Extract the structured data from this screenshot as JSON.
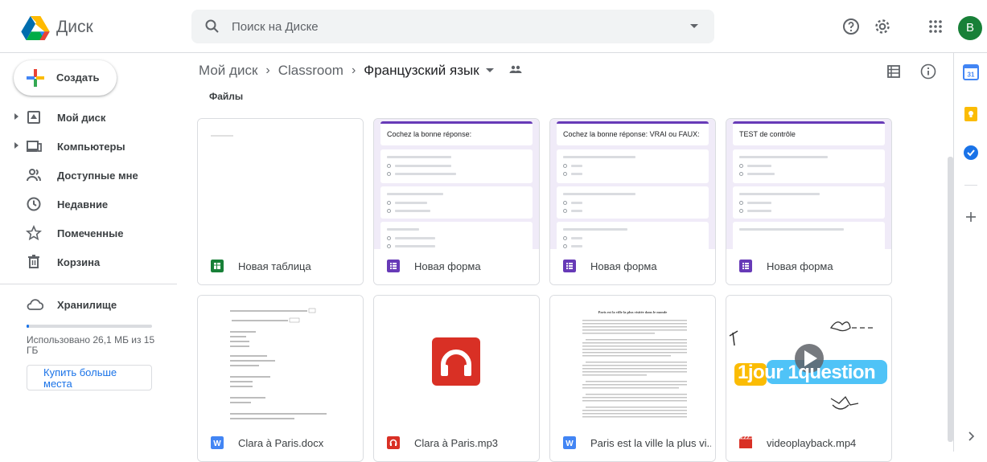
{
  "app": {
    "name": "Диск"
  },
  "search": {
    "placeholder": "Поиск на Диске"
  },
  "header": {
    "avatar_letter": "B",
    "icons": [
      "help-icon",
      "settings-icon",
      "apps-grid-icon"
    ]
  },
  "sidebar": {
    "create_label": "Создать",
    "items": [
      {
        "label": "Мой диск",
        "icon": "drive-icon",
        "expandable": true
      },
      {
        "label": "Компьютеры",
        "icon": "computer-icon",
        "expandable": true
      },
      {
        "label": "Доступные мне",
        "icon": "shared-icon",
        "expandable": false
      },
      {
        "label": "Недавние",
        "icon": "clock-icon",
        "expandable": false
      },
      {
        "label": "Помеченные",
        "icon": "star-icon",
        "expandable": false
      },
      {
        "label": "Корзина",
        "icon": "trash-icon",
        "expandable": false
      }
    ],
    "storage_label": "Хранилище",
    "storage_used": "Использовано 26,1 МБ из 15 ГБ",
    "storage_fraction": 0.002,
    "buy_label": "Купить больше места"
  },
  "breadcrumb": {
    "items": [
      "Мой диск",
      "Classroom",
      "Французский язык"
    ]
  },
  "section": {
    "files_label": "Файлы"
  },
  "files": [
    {
      "name": "Новая таблица",
      "type": "sheets",
      "icon_color": "#188038"
    },
    {
      "name": "Новая форма",
      "type": "forms",
      "icon_color": "#673ab7",
      "thumb_title": "Cochez la bonne réponse:"
    },
    {
      "name": "Новая форма",
      "type": "forms",
      "icon_color": "#673ab7",
      "thumb_title": "Cochez la bonne réponse: VRAI ou FAUX:"
    },
    {
      "name": "Новая форма",
      "type": "forms",
      "icon_color": "#673ab7",
      "thumb_title": "TEST de contrôle"
    },
    {
      "name": "Clara à Paris.docx",
      "type": "docx",
      "icon_color": "#4285f4"
    },
    {
      "name": "Clara à Paris.mp3",
      "type": "audio",
      "icon_color": "#d93025"
    },
    {
      "name": "Paris est la ville la plus vi...",
      "type": "docx",
      "icon_color": "#4285f4",
      "thumb_title": "Paris est la ville la plus visitée dans le monde"
    },
    {
      "name": "videoplayback.mp4",
      "type": "video",
      "icon_color": "#d93025",
      "thumb_title": "1jour 1question"
    }
  ],
  "colors": {
    "accent": "#1a73e8",
    "forms": "#673ab7",
    "avatar": "#188038"
  }
}
